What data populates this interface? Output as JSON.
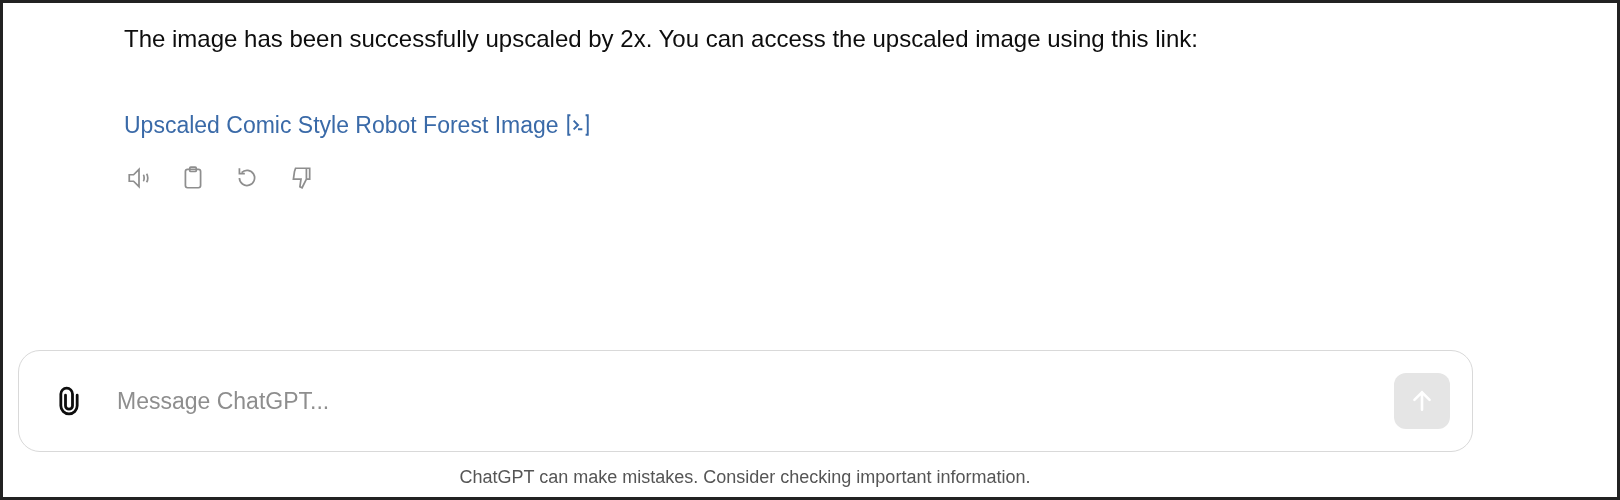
{
  "message": {
    "text": "The image has been successfully upscaled by 2x. You can access the upscaled image using this link:",
    "link": "Upscaled Comic Style Robot Forest Image"
  },
  "composer": {
    "placeholder": "Message ChatGPT...",
    "send_disabled": true
  },
  "footer": "ChatGPT can make mistakes. Consider checking important information."
}
